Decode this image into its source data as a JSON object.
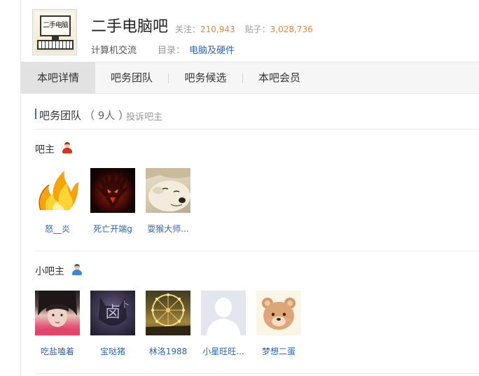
{
  "header": {
    "logo_text": "二手电脑",
    "forum_name": "二手电脑吧",
    "follow_label": "关注：",
    "follow_count": "210,943",
    "posts_label": "贴子：",
    "posts_count": "3,028,736",
    "category": "计算机交流",
    "directory_label": "目录：",
    "directory_value": "电脑及硬件"
  },
  "tabs": [
    {
      "label": "本吧详情",
      "active": true
    },
    {
      "label": "吧务团队",
      "active": false
    },
    {
      "label": "吧务候选",
      "active": false
    },
    {
      "label": "本吧会员",
      "active": false
    }
  ],
  "section": {
    "title": "吧务团队",
    "count": "（ 9人 ）",
    "report_link": "投诉吧主"
  },
  "owners": {
    "label": "吧主",
    "icon": "owner-person-icon",
    "members": [
      {
        "name": "怒__炎",
        "avatar": "flame-avatar"
      },
      {
        "name": "死亡开端g",
        "avatar": "demon-avatar"
      },
      {
        "name": "耍猴大师...",
        "avatar": "dog-avatar"
      }
    ]
  },
  "moderators": {
    "label": "小吧主",
    "icon": "moderator-person-icon",
    "members": [
      {
        "name": "吃盐嗑着",
        "avatar": "girl-avatar"
      },
      {
        "name": "宝哒猪",
        "avatar": "cat-avatar"
      },
      {
        "name": "林洛1988",
        "avatar": "ferris-wheel-avatar"
      },
      {
        "name": "小星旺旺...",
        "avatar": "default-avatar"
      },
      {
        "name": "梦想二蛋",
        "avatar": "bear-avatar"
      }
    ]
  },
  "colors": {
    "accent_blue": "#2d64b3",
    "count_orange": "#f4842e",
    "active_tab_bg": "#e2e2e2"
  }
}
